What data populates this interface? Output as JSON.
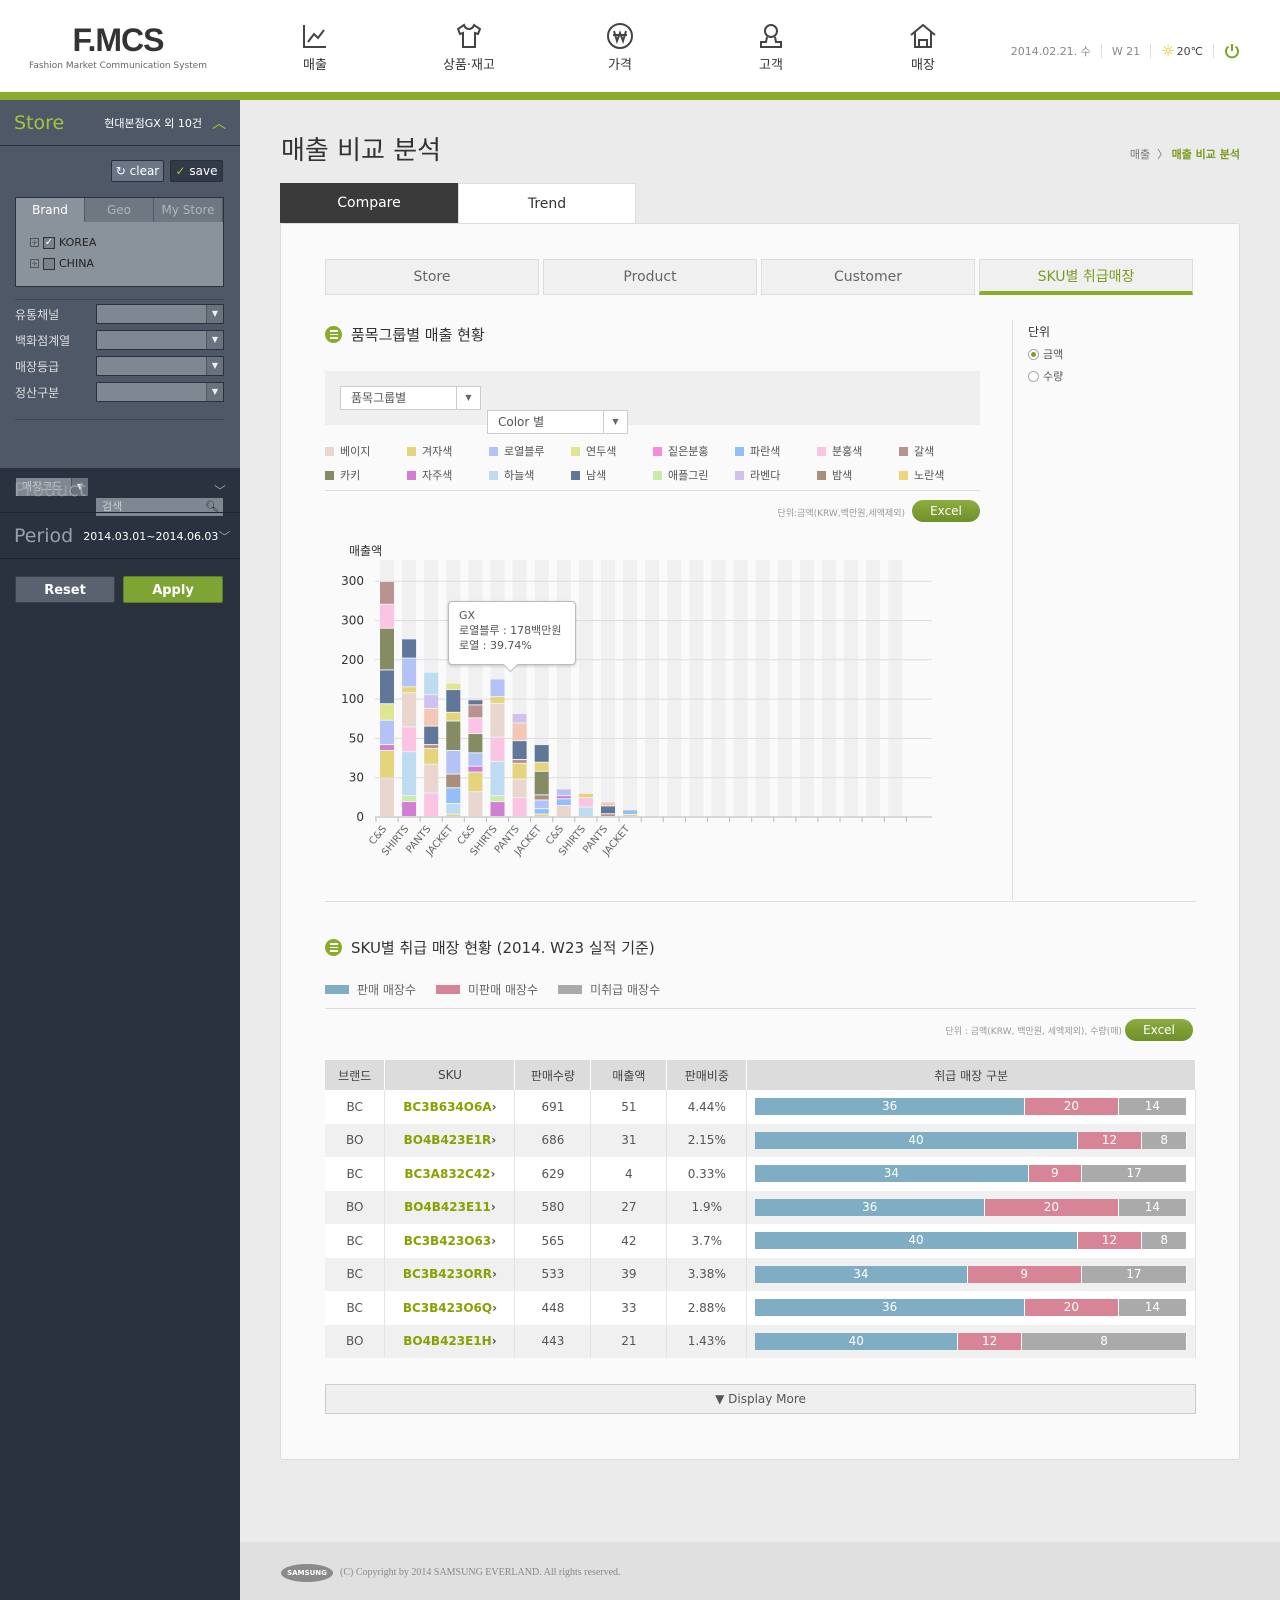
{
  "header": {
    "logo": "F.MCS",
    "logo_sub": "Fashion Market Communication System",
    "nav": [
      {
        "label": "매출",
        "icon": "chart-line-icon"
      },
      {
        "label": "상품·재고",
        "icon": "shirt-icon"
      },
      {
        "label": "가격",
        "icon": "won-icon"
      },
      {
        "label": "고객",
        "icon": "person-icon"
      },
      {
        "label": "매장",
        "icon": "store-house-icon"
      }
    ],
    "date": "2014.02.21. 수",
    "week": "W 21",
    "weather": "20℃"
  },
  "sidebar": {
    "store_title": "Store",
    "store_value": "현대본점GX 외 10건",
    "clear": "clear",
    "save": "save",
    "tabs": [
      "Brand",
      "Geo",
      "My Store"
    ],
    "tree": [
      {
        "label": "KOREA",
        "checked": true
      },
      {
        "label": "CHINA",
        "checked": false
      }
    ],
    "filters": [
      "유통채널",
      "백화점계열",
      "매장등급",
      "정산구분"
    ],
    "code_select": "매장코드",
    "search_placeholder": "검색",
    "product_title": "Product",
    "period_title": "Period",
    "period_value": "2014.03.01~2014.06.03",
    "reset": "Reset",
    "apply": "Apply"
  },
  "page": {
    "title": "매출 비교 분석",
    "breadcrumb": [
      "매출",
      "매출 비교 분석"
    ],
    "main_tabs": [
      "Compare",
      "Trend"
    ],
    "sub_tabs": [
      "Store",
      "Product",
      "Customer",
      "SKU별 취급매장"
    ]
  },
  "section1": {
    "title": "품목그룹별 매출 현황",
    "unit_title": "단위",
    "unit_options": [
      "금액",
      "수량"
    ],
    "select1": "품목그룹별",
    "select2": "Color 별",
    "unit_note": "단위:금액(KRW,백만원,세액제외)",
    "excel": "Excel",
    "legend": [
      {
        "key": "beige",
        "label": "베이지",
        "color": "#e8d6cf"
      },
      {
        "key": "mustard",
        "label": "겨자색",
        "color": "#e6d47c"
      },
      {
        "key": "royal",
        "label": "로열블루",
        "color": "#b3c3f7"
      },
      {
        "key": "lime",
        "label": "연두색",
        "color": "#dfe68f"
      },
      {
        "key": "hotpink",
        "label": "짙은분홍",
        "color": "#f988e0"
      },
      {
        "key": "blue",
        "label": "파란색",
        "color": "#92bff6"
      },
      {
        "key": "pink",
        "label": "분홍색",
        "color": "#fcc4e3"
      },
      {
        "key": "brown",
        "label": "갈색",
        "color": "#b8938f"
      },
      {
        "key": "khaki",
        "label": "카키",
        "color": "#858b62"
      },
      {
        "key": "magenta",
        "label": "자주색",
        "color": "#d07fd2"
      },
      {
        "key": "sky",
        "label": "하늘색",
        "color": "#bddcf2"
      },
      {
        "key": "navy",
        "label": "남색",
        "color": "#60779a"
      },
      {
        "key": "apple",
        "label": "애플그린",
        "color": "#c9ecaa"
      },
      {
        "key": "lavender",
        "label": "라벤다",
        "color": "#cfc2ef"
      },
      {
        "key": "chestnut",
        "label": "밤색",
        "color": "#a98e7a"
      },
      {
        "key": "yellow",
        "label": "노란색",
        "color": "#f2d675"
      }
    ]
  },
  "chart_data": {
    "type": "bar",
    "stacked": true,
    "ylabel": "매출액",
    "yticks": [
      "0",
      "30",
      "50",
      "100",
      "200",
      "300",
      "300"
    ],
    "categories": [
      "C&S",
      "SHIRTS",
      "PANTS",
      "JACKET",
      "C&S",
      "SHIRTS",
      "PANTS",
      "JACKET",
      "C&S",
      "SHIRTS",
      "PANTS",
      "JACKET"
    ],
    "empty_columns": 12,
    "note": "segment values in tick-index units (axis labels are non-linear)",
    "bars": [
      [
        [
          "beige",
          0.98
        ],
        [
          "mustard",
          0.7
        ],
        [
          "magenta",
          0.15
        ],
        [
          "royal",
          0.62
        ],
        [
          "lime",
          0.42
        ],
        [
          "navy",
          0.86
        ],
        [
          "khaki",
          1.06
        ],
        [
          "pink",
          0.61
        ],
        [
          "brown",
          0.58
        ]
      ],
      [
        [
          "magenta",
          0.38
        ],
        [
          "apple",
          0.15
        ],
        [
          "sky",
          1.12
        ],
        [
          "pink",
          0.63
        ],
        [
          "beige",
          0.87
        ],
        [
          "mustard",
          0.15
        ],
        [
          "royal",
          0.73
        ],
        [
          "navy",
          0.49
        ]
      ],
      [
        [
          "pink",
          0.6
        ],
        [
          "beige",
          0.73
        ],
        [
          "mustard",
          0.4
        ],
        [
          "brown",
          0.1
        ],
        [
          "navy",
          0.47
        ],
        [
          "salmon",
          0.45
        ],
        [
          "lavender",
          0.35
        ],
        [
          "sky",
          0.57
        ]
      ],
      [
        [
          "mustard",
          0.06
        ],
        [
          "sky",
          0.27
        ],
        [
          "blue",
          0.4
        ],
        [
          "chestnut",
          0.35
        ],
        [
          "royal",
          0.6
        ],
        [
          "khaki",
          0.75
        ],
        [
          "mustard",
          0.22
        ],
        [
          "navy",
          0.58
        ],
        [
          "lime",
          0.16
        ]
      ],
      [
        [
          "beige",
          0.63
        ],
        [
          "mustard",
          0.5
        ],
        [
          "magenta",
          0.15
        ],
        [
          "royal",
          0.34
        ],
        [
          "khaki",
          0.49
        ],
        [
          "pink",
          0.4
        ],
        [
          "brown",
          0.33
        ],
        [
          "navy",
          0.13
        ]
      ],
      [
        [
          "magenta",
          0.38
        ],
        [
          "apple",
          0.15
        ],
        [
          "sky",
          0.87
        ],
        [
          "pink",
          0.62
        ],
        [
          "beige",
          0.86
        ],
        [
          "mustard",
          0.17
        ],
        [
          "royal",
          0.45
        ]
      ],
      [
        [
          "pink",
          0.48
        ],
        [
          "beige",
          0.47
        ],
        [
          "mustard",
          0.4
        ],
        [
          "brown",
          0.1
        ],
        [
          "navy",
          0.48
        ],
        [
          "salmon",
          0.45
        ],
        [
          "lavender",
          0.24
        ]
      ],
      [
        [
          "mustard",
          0.06
        ],
        [
          "blue",
          0.14
        ],
        [
          "royal",
          0.22
        ],
        [
          "chestnut",
          0.13
        ],
        [
          "khaki",
          0.6
        ],
        [
          "mustard",
          0.23
        ],
        [
          "navy",
          0.45
        ]
      ],
      [
        [
          "beige",
          0.28
        ],
        [
          "blue",
          0.17
        ],
        [
          "magenta",
          0.08
        ],
        [
          "royal",
          0.17
        ]
      ],
      [
        [
          "sky",
          0.24
        ],
        [
          "pink",
          0.24
        ],
        [
          "mustard",
          0.11
        ]
      ],
      [
        [
          "brown",
          0.07
        ],
        [
          "navy",
          0.2
        ],
        [
          "salmon",
          0.1
        ]
      ],
      [
        [
          "mustard",
          0.05
        ],
        [
          "blue",
          0.12
        ]
      ]
    ],
    "extra_colors": {
      "salmon": "#f3c6b6"
    },
    "tooltip": {
      "bar_index": 5,
      "title": "GX",
      "line1": "로열블루 : 178백만원",
      "line2": "로열 : 39.74%"
    }
  },
  "section2": {
    "title": "SKU별 취급 매장 현황 (2014. W23 실적 기준)",
    "legend": [
      {
        "label": "판매 매장수",
        "color": "#7fadc4"
      },
      {
        "label": "미판매 매장수",
        "color": "#d68496"
      },
      {
        "label": "미취급 매장수",
        "color": "#aaaaaa"
      }
    ],
    "unit_note": "단위 : 금액(KRW, 백만원, 세액제외), 수량(매)",
    "excel": "Excel",
    "columns": [
      "브랜드",
      "SKU",
      "판매수량",
      "매출액",
      "판매비중",
      "취급 매장 구분"
    ],
    "rows": [
      {
        "brand": "BC",
        "sku": "BC3B634O6A",
        "qty": "691",
        "amount": "51",
        "ratio": "4.44%",
        "stores": [
          36,
          20,
          14
        ],
        "shares": [
          0.627,
          0.216,
          0.157
        ]
      },
      {
        "brand": "BO",
        "sku": "BO4B423E1R",
        "qty": "686",
        "amount": "31",
        "ratio": "2.15%",
        "stores": [
          40,
          12,
          8
        ],
        "shares": [
          0.75,
          0.148,
          0.102
        ]
      },
      {
        "brand": "BC",
        "sku": "BC3A832C42",
        "qty": "629",
        "amount": "4",
        "ratio": "0.33%",
        "stores": [
          34,
          9,
          17
        ],
        "shares": [
          0.635,
          0.123,
          0.242
        ]
      },
      {
        "brand": "BO",
        "sku": "BO4B423E11",
        "qty": "580",
        "amount": "27",
        "ratio": "1.9%",
        "stores": [
          36,
          20,
          14
        ],
        "shares": [
          0.534,
          0.309,
          0.157
        ]
      },
      {
        "brand": "BC",
        "sku": "BC3B423O63",
        "qty": "565",
        "amount": "42",
        "ratio": "3.7%",
        "stores": [
          40,
          12,
          8
        ],
        "shares": [
          0.75,
          0.148,
          0.102
        ]
      },
      {
        "brand": "BC",
        "sku": "BC3B423ORR",
        "qty": "533",
        "amount": "39",
        "ratio": "3.38%",
        "stores": [
          34,
          9,
          17
        ],
        "shares": [
          0.493,
          0.264,
          0.243
        ]
      },
      {
        "brand": "BC",
        "sku": "BC3B423O6Q",
        "qty": "448",
        "amount": "33",
        "ratio": "2.88%",
        "stores": [
          36,
          20,
          14
        ],
        "shares": [
          0.627,
          0.216,
          0.157
        ]
      },
      {
        "brand": "BO",
        "sku": "BO4B423E1H",
        "qty": "443",
        "amount": "21",
        "ratio": "1.43%",
        "stores": [
          40,
          12,
          8
        ],
        "shares": [
          0.471,
          0.147,
          0.382
        ]
      }
    ],
    "display_more": "Display More"
  },
  "footer": {
    "copyright": "(C) Copyright by 2014 SAMSUNG EVERLAND. All rights reserved.",
    "logo": "SAMSUNG"
  }
}
